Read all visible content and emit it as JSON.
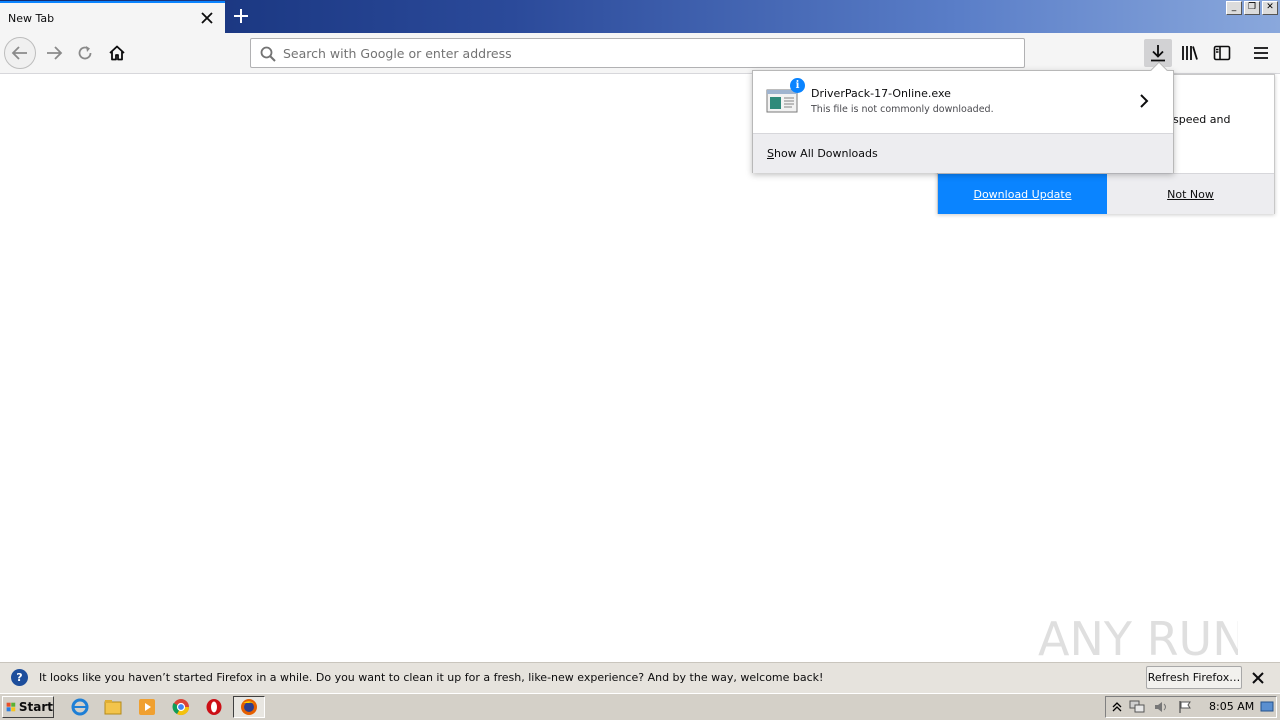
{
  "browser": {
    "tab_title": "New Tab",
    "url_placeholder": "Search with Google or enter address"
  },
  "downloads_panel": {
    "file_name": "DriverPack-17-Online.exe",
    "file_status": "This file is not commonly downloaded.",
    "show_all_prefix": "S",
    "show_all_rest": "how All Downloads"
  },
  "update_panel": {
    "partial_text": "speed and",
    "download_update_label": "Download Update",
    "not_now_label": "Not Now"
  },
  "notification": {
    "message": "It looks like you haven’t started Firefox in a while. Do you want to clean it up for a fresh, like-new experience? And by the way, welcome back!",
    "refresh_label": "Refresh Firefox…"
  },
  "taskbar": {
    "start_label": "Start",
    "clock": "8:05 AM"
  },
  "watermark_text": "ANY RUN",
  "colors": {
    "accent": "#0a84ff",
    "notification_bg": "#e6e3dd",
    "taskbar_bg": "#d4d0c8"
  }
}
